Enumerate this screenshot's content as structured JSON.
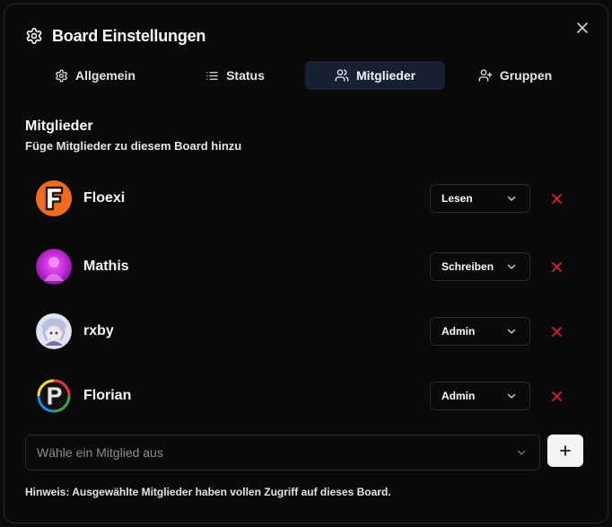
{
  "dialog": {
    "title": "Board Einstellungen",
    "title_icon": "gear-icon",
    "close_icon": "close-icon"
  },
  "tabs": [
    {
      "label": "Allgemein",
      "icon": "gear-icon",
      "active": false
    },
    {
      "label": "Status",
      "icon": "list-icon",
      "active": false
    },
    {
      "label": "Mitglieder",
      "icon": "users-icon",
      "active": true
    },
    {
      "label": "Gruppen",
      "icon": "user-plus-icon",
      "active": false
    }
  ],
  "section": {
    "title": "Mitglieder",
    "subtitle": "Füge Mitglieder zu diesem Board hinzu"
  },
  "members": [
    {
      "name": "Floexi",
      "role": "Lesen",
      "avatar": "floexi-avatar"
    },
    {
      "name": "Mathis",
      "role": "Schreiben",
      "avatar": "mathis-avatar"
    },
    {
      "name": "rxby",
      "role": "Admin",
      "avatar": "rxby-avatar"
    },
    {
      "name": "Florian",
      "role": "Admin",
      "avatar": "florian-avatar"
    }
  ],
  "picker": {
    "placeholder": "Wähle ein Mitglied aus",
    "add_label": "+"
  },
  "hint": "Hinweis: Ausgewählte Mitglieder haben vollen Zugriff auf dieses Board.",
  "colors": {
    "background": "#0a0a0a",
    "border": "#2a2a2e",
    "active_tab": "#172032",
    "remove": "#e11d2e",
    "add_button": "#f4f4f5"
  }
}
